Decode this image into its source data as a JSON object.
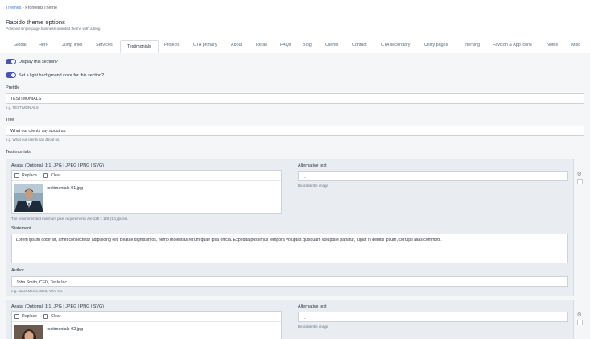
{
  "breadcrumb": {
    "link": "Themes",
    "separator": "›",
    "current": "Frontend Theme"
  },
  "header": {
    "title": "Rapido theme options",
    "subtitle": "Polished single-page business-oriented theme with a blog."
  },
  "tabs": [
    "Global",
    "Hero",
    "Jump links",
    "Services",
    "Testimonials",
    "Projects",
    "CTA primary",
    "About",
    "Retail",
    "FAQs",
    "Blog",
    "Clients",
    "Contact",
    "CTA secondary",
    "Utility pages",
    "Theming",
    "Favicon & App icons",
    "Notes",
    "Misc"
  ],
  "active_tab": "Testimonials",
  "toggles": {
    "display_section": "Display this section?",
    "light_background": "Set a light background color for this section?"
  },
  "pretitle": {
    "label": "Pretitle",
    "value": "TESTIMONIALS",
    "hint": "e.g. TESTIMONIALS"
  },
  "title": {
    "label": "Title",
    "value": "What our clients say about us.",
    "hint": "e.g. What our clients say about us."
  },
  "testimonials_label": "Testimonials",
  "items": [
    {
      "avatar_label": "Avatar (Optional, 1:1, JPG | JPEG | PNG | SVG)",
      "replace": "Replace",
      "clear": "Clear",
      "filename": "testimonials-01.jpg",
      "pixel_hint": "The recommended minimum pixel requirements are 128 × 128 (1:1) pixels.",
      "alt_label": "Alternative text",
      "alt_placeholder": "...",
      "alt_hint": "Describe the image",
      "statement_label": "Statement",
      "statement": "Lorem ipsum dolor sit, amet consectetur adipisicing elit. Beatae dignissimos, nemo molestias rerum quae ipsa officia. Expedita possimus tempora voluptas quisquam voluptate pariatur, fugiat in debitis ipsum, corrupti alias commodi.",
      "author_label": "Author",
      "author": "John Smith, CFO, Tesla Inc.",
      "author_hint": "e.g. Janet Morris, CEO, Wire Inc."
    },
    {
      "avatar_label": "Avatar (Optional, 1:1, JPG | JPEG | PNG | SVG)",
      "replace": "Replace",
      "clear": "Clear",
      "filename": "testimonials-02.jpg",
      "alt_label": "Alternative text",
      "alt_placeholder": "...",
      "alt_hint": "Describe the image"
    }
  ],
  "icons": {
    "drag": "drag-handle-icon",
    "settings": "gear-icon",
    "replace": "replace-icon",
    "clear": "clear-icon"
  },
  "colors": {
    "accent": "#4a55b8",
    "link": "#2f7fd8"
  }
}
